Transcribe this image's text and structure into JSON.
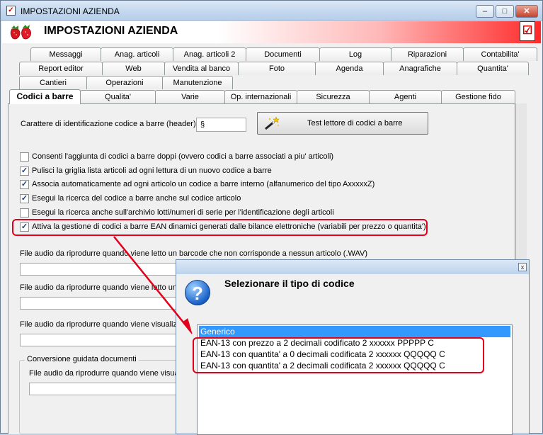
{
  "window": {
    "title": "IMPOSTAZIONI AZIENDA",
    "minimize": "–",
    "maximize": "□",
    "close": "✕"
  },
  "header": {
    "title": "IMPOSTAZIONI AZIENDA",
    "check_glyph": "☑"
  },
  "tabs": {
    "row1": [
      "Messaggi",
      "Anag. articoli",
      "Anag. articoli 2",
      "Documenti",
      "Log",
      "Riparazioni",
      "Contabilita'"
    ],
    "row2": [
      "Report editor",
      "Web",
      "Vendita al banco",
      "Foto",
      "Agenda",
      "Anagrafiche",
      "Quantita'"
    ],
    "row3": [
      "Cantieri",
      "Operazioni",
      "Manutenzione"
    ],
    "row4": [
      "Codici a barre",
      "Qualita'",
      "Varie",
      "Op. internazionali",
      "Sicurezza",
      "Agenti",
      "Gestione fido"
    ]
  },
  "barcode": {
    "label": "Carattere di identificazione codice a barre (header) :",
    "header_value": "§",
    "test_button": "Test lettore di codici a barre"
  },
  "options": [
    {
      "label": "Consenti l'aggiunta di codici a barre doppi (ovvero codici a barre associati a piu' articoli)",
      "checked": false
    },
    {
      "label": "Pulisci la griglia lista articoli ad ogni lettura di un nuovo codice a barre",
      "checked": true
    },
    {
      "label": "Associa automaticamente ad ogni articolo un codice a barre interno (alfanumerico del tipo AxxxxxZ)",
      "checked": true
    },
    {
      "label": "Esegui la ricerca del codice a barre anche sul codice articolo",
      "checked": true
    },
    {
      "label": "Esegui la ricerca anche sull'archivio lotti/numeri di serie per l'identificazione degli articoli",
      "checked": false
    },
    {
      "label": "Attiva la gestione di codici a barre EAN dinamici generati dalle bilance elettroniche (variabili per prezzo o quantita')",
      "checked": true
    }
  ],
  "audio": {
    "label1": "File audio da riprodurre quando viene letto un barcode che non corrisponde a nessun articolo (.WAV)",
    "label2": "File audio da riprodurre quando viene letto un b",
    "label3": "File audio da riprodurre quando viene visualizz",
    "group_title": "Conversione guidata documenti",
    "label4": "File audio da riprodurre quando viene visuali"
  },
  "dialog": {
    "title": "Selezionare il tipo di codice",
    "close": "x",
    "question_glyph": "?",
    "items": [
      "Generico",
      "EAN-13 con prezzo a 2 decimali codificato   2 xxxxxx PPPPP C",
      "EAN-13 con quantita' a 0 decimali codificata   2 xxxxxx QQQQQ C",
      "EAN-13 con quantita' a 2 decimali codificata   2 xxxxxx QQQQQ C"
    ],
    "selected_index": 0
  },
  "colors": {
    "highlight": "#e2001a",
    "selection": "#3399ff",
    "check": "#1c3d78"
  }
}
